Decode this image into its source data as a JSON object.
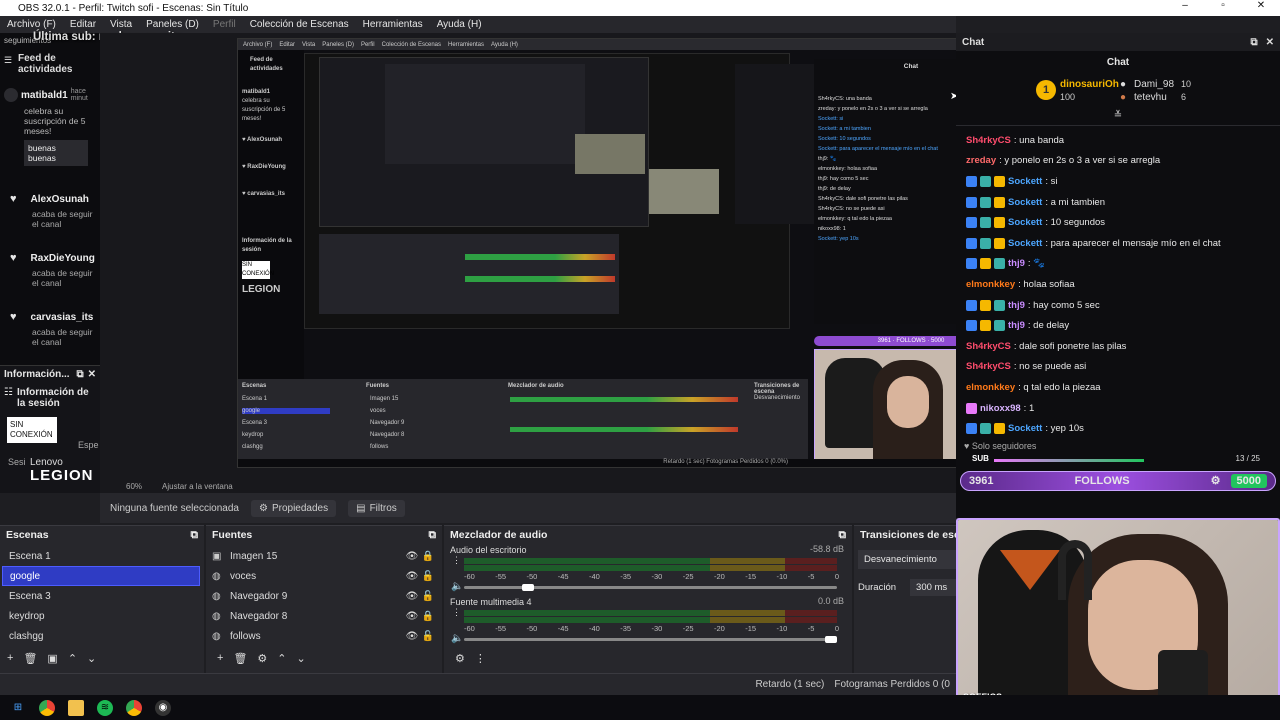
{
  "window": {
    "title": "OBS 32.0.1 - Perfil: Twitch sofi - Escenas: Sin Título",
    "minimize": "–",
    "maximize": "▫",
    "close": "✕"
  },
  "menu": [
    "Archivo (F)",
    "Editar",
    "Vista",
    "Paneles (D)",
    "Perfil",
    "Colección de Escenas",
    "Herramientas",
    "Ayuda (H)"
  ],
  "overlay": {
    "last_sub": "Última sub: nachonumerito"
  },
  "activity_feed": {
    "title": "Feed de actividades",
    "truncated_label": "seguimientos",
    "items": [
      {
        "name": "matibald1",
        "time": "hace minut",
        "text": "celebra su suscripción de 5 meses!",
        "msg": "buenas buenas"
      },
      {
        "name": "AlexOsunah",
        "text": "acaba de seguir el canal"
      },
      {
        "name": "RaxDieYoung",
        "text": "acaba de seguir el canal"
      },
      {
        "name": "carvasias_its",
        "text": "acaba de seguir el canal"
      }
    ]
  },
  "session_info": {
    "title": "Información...",
    "heading": "Información de la sesión",
    "status": "SIN CONEXIÓN",
    "partial1": "Espe",
    "partial2": "Sesi"
  },
  "logo": {
    "brand": "Lenovo",
    "model": "LEGION"
  },
  "preview_toolbar": {
    "zoom": "60%",
    "fit": "Ajustar a la ventana"
  },
  "context_bar": {
    "no_source": "Ninguna fuente seleccionada",
    "properties": "Propiedades",
    "filters": "Filtros"
  },
  "scenes": {
    "title": "Escenas",
    "items": [
      "Escena 1",
      "google",
      "Escena 3",
      "keydrop",
      "clashgg"
    ],
    "selected": 1
  },
  "sources": {
    "title": "Fuentes",
    "items": [
      {
        "name": "Imagen 15",
        "icon": "image-icon"
      },
      {
        "name": "voces",
        "icon": "globe-icon"
      },
      {
        "name": "Navegador 9",
        "icon": "globe-icon"
      },
      {
        "name": "Navegador 8",
        "icon": "globe-icon"
      },
      {
        "name": "follows",
        "icon": "globe-icon"
      }
    ]
  },
  "mixer": {
    "title": "Mezclador de audio",
    "channels": [
      {
        "name": "Audio del escritorio",
        "db": "-58.8 dB",
        "level": 0.16
      },
      {
        "name": "Fuente multimedia 4",
        "db": "0.0 dB",
        "level": 1.0
      }
    ],
    "scale": [
      "-60",
      "-55",
      "-50",
      "-45",
      "-40",
      "-35",
      "-30",
      "-25",
      "-20",
      "-15",
      "-10",
      "-5",
      "0"
    ]
  },
  "transitions": {
    "title": "Transiciones de escena",
    "type": "Desvanecimiento",
    "duration_label": "Duración",
    "duration": "300 ms"
  },
  "status": {
    "delay": "Retardo (1 sec)",
    "frames": "Fotogramas Perdidos 0 (0"
  },
  "chat": {
    "dock_title": "Chat",
    "header": "Chat",
    "leaders": [
      {
        "name": "dinosauriOh",
        "count": "100"
      },
      {
        "name": "Dami_98",
        "count": "10"
      },
      {
        "name": "tetevhu",
        "count": "6"
      }
    ],
    "messages": [
      {
        "user": "Sh4rkyCS",
        "color": "#ff4d6d",
        "badges": [],
        "text": ": una banda"
      },
      {
        "user": "zreday",
        "color": "#ff6a6a",
        "badges": [],
        "text": ": y ponelo en 2s o 3 a ver si se arregla"
      },
      {
        "user": "Sockett",
        "color": "#4da6ff",
        "badges": [
          "#3b82f6",
          "#3ab0a8",
          "#f5b800"
        ],
        "text": ": si"
      },
      {
        "user": "Sockett",
        "color": "#4da6ff",
        "badges": [
          "#3b82f6",
          "#3ab0a8",
          "#f5b800"
        ],
        "text": ": a mi tambien"
      },
      {
        "user": "Sockett",
        "color": "#4da6ff",
        "badges": [
          "#3b82f6",
          "#3ab0a8",
          "#f5b800"
        ],
        "text": ": 10 segundos"
      },
      {
        "user": "Sockett",
        "color": "#4da6ff",
        "badges": [
          "#3b82f6",
          "#3ab0a8",
          "#f5b800"
        ],
        "text": ": para aparecer el mensaje mío en el chat"
      },
      {
        "user": "thj9",
        "color": "#c98cff",
        "badges": [
          "#3b82f6",
          "#f5b800",
          "#3ab0a8"
        ],
        "text": ": 🐾"
      },
      {
        "user": "elmonkkey",
        "color": "#ff7a1a",
        "badges": [],
        "text": ": holaa sofiaa"
      },
      {
        "user": "thj9",
        "color": "#c98cff",
        "badges": [
          "#3b82f6",
          "#f5b800",
          "#3ab0a8"
        ],
        "text": ": hay como 5 sec"
      },
      {
        "user": "thj9",
        "color": "#c98cff",
        "badges": [
          "#3b82f6",
          "#f5b800",
          "#3ab0a8"
        ],
        "text": ": de delay"
      },
      {
        "user": "Sh4rkyCS",
        "color": "#ff4d6d",
        "badges": [],
        "text": ": dale sofi ponetre las pilas"
      },
      {
        "user": "Sh4rkyCS",
        "color": "#ff4d6d",
        "badges": [],
        "text": ": no se puede asi"
      },
      {
        "user": "elmonkkey",
        "color": "#ff7a1a",
        "badges": [],
        "text": ": q tal edo la piezaa"
      },
      {
        "user": "nikoxx98",
        "color": "#d8b4fe",
        "badges": [
          "#e879f9"
        ],
        "text": ": 1"
      },
      {
        "user": "Sockett",
        "color": "#4da6ff",
        "badges": [
          "#3b82f6",
          "#3ab0a8",
          "#f5b800"
        ],
        "text": ": yep 10s"
      }
    ],
    "followers_only": "Solo seguidores",
    "sub_label": "SUB",
    "goal_progress": "13 / 25",
    "follows_count": "3961",
    "follows_label": "FOLLOWS",
    "follows_goal": "5000"
  },
  "webcam": {
    "caption": "SOFFICS"
  },
  "colors": {
    "accent": "#2f3cc4",
    "obs_bg": "#27272c",
    "follow_purple": "#8e4bd1",
    "goal_green": "#22c55e"
  }
}
